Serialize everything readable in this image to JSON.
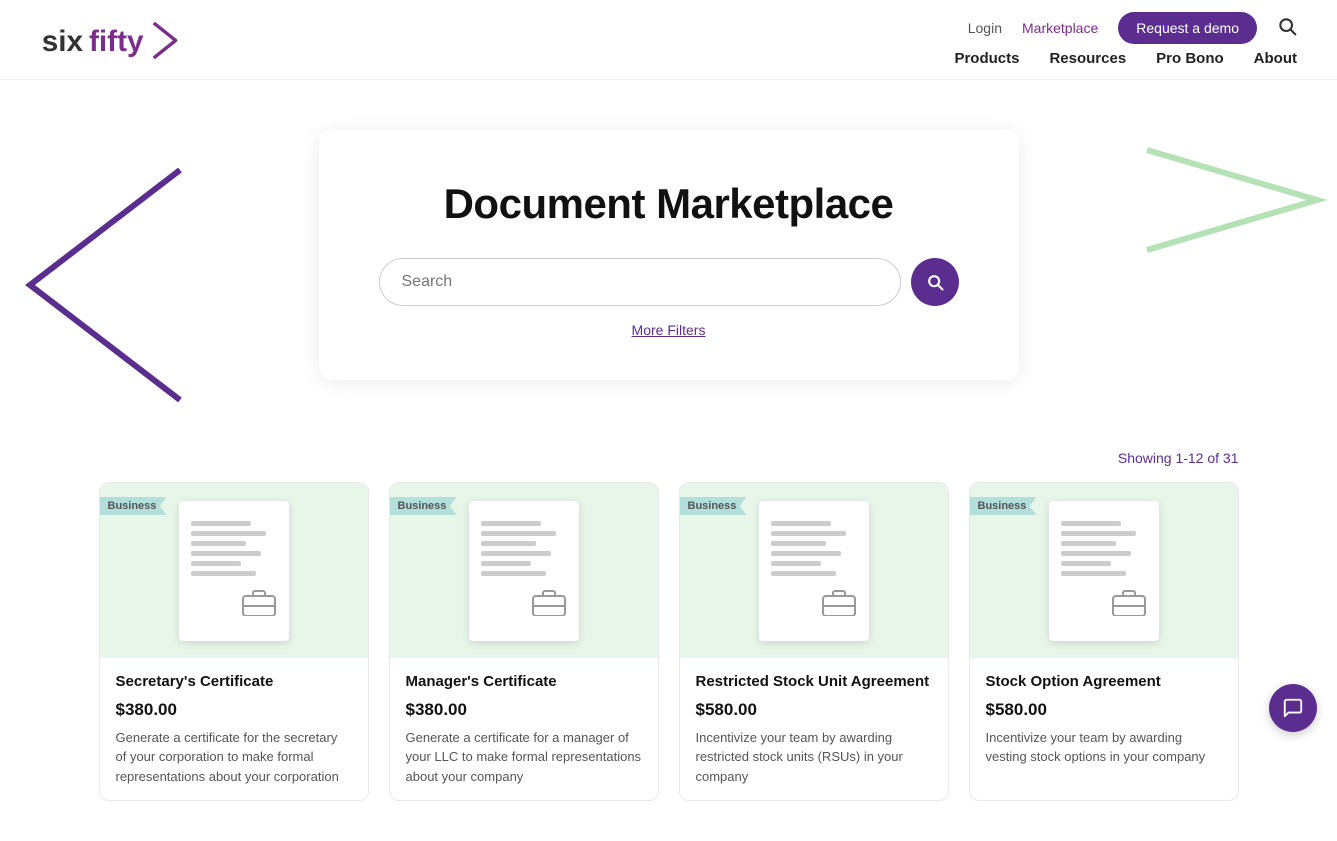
{
  "nav": {
    "logo_text": "sixfifty",
    "login_label": "Login",
    "marketplace_label": "Marketplace",
    "demo_btn_label": "Request a demo",
    "search_icon": "search-icon",
    "bottom_links": [
      {
        "label": "Products",
        "id": "products"
      },
      {
        "label": "Resources",
        "id": "resources"
      },
      {
        "label": "Pro Bono",
        "id": "pro-bono"
      },
      {
        "label": "About",
        "id": "about"
      }
    ]
  },
  "hero": {
    "title": "Document Marketplace",
    "search_placeholder": "Search",
    "more_filters_label": "More Filters"
  },
  "results": {
    "count_label": "Showing 1-12 of 31"
  },
  "cards": [
    {
      "badge": "Business",
      "title": "Secretary's Certificate",
      "price": "$380.00",
      "desc": "Generate a certificate for the secretary of your corporation to make formal representations about your corporation"
    },
    {
      "badge": "Business",
      "title": "Manager's Certificate",
      "price": "$380.00",
      "desc": "Generate a certificate for a manager of your LLC to make formal representations about your company"
    },
    {
      "badge": "Business",
      "title": "Restricted Stock Unit Agreement",
      "price": "$580.00",
      "desc": "Incentivize your team by awarding restricted stock units (RSUs) in your company"
    },
    {
      "badge": "Business",
      "title": "Stock Option Agreement",
      "price": "$580.00",
      "desc": "Incentivize your team by awarding vesting stock options in your company"
    }
  ],
  "colors": {
    "purple": "#5b2d8e",
    "green_badge": "#b2dfdb",
    "green_deco": "#b5e2b5"
  }
}
